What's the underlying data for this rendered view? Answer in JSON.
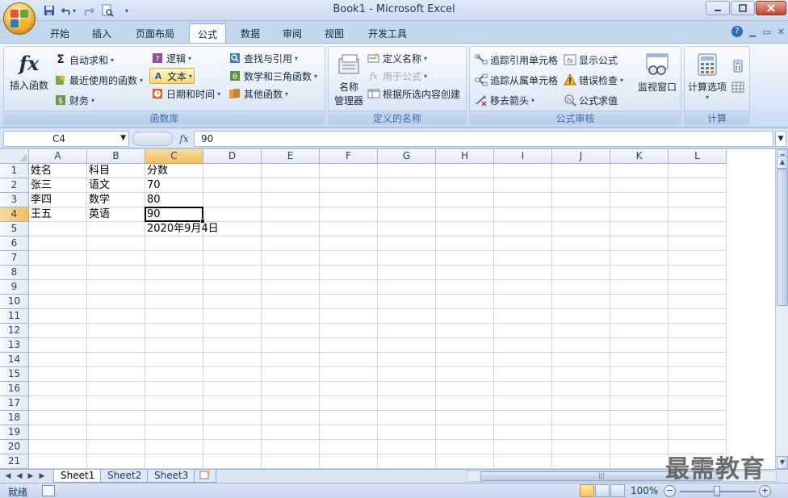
{
  "window": {
    "title": "Book1 - Microsoft Excel",
    "controls": [
      "minimize",
      "restore",
      "close"
    ]
  },
  "quick_access": [
    {
      "name": "save-icon",
      "label": "Save"
    },
    {
      "name": "undo-icon",
      "label": "Undo"
    },
    {
      "name": "redo-icon",
      "label": "Redo"
    },
    {
      "name": "print-preview-icon",
      "label": "Print Preview"
    },
    {
      "name": "customize-qat-icon",
      "label": "Customize"
    }
  ],
  "ribbon_tabs": [
    "开始",
    "插入",
    "页面布局",
    "公式",
    "数据",
    "审阅",
    "视图",
    "开发工具"
  ],
  "active_tab": "公式",
  "ribbon": {
    "function_library": {
      "label": "函数库",
      "insert_function": "插入函数",
      "autosum": "自动求和",
      "recent": "最近使用的函数",
      "financial": "财务",
      "logical": "逻辑",
      "text": "文本",
      "datetime": "日期和时间",
      "lookup": "查找与引用",
      "math": "数学和三角函数",
      "more": "其他函数"
    },
    "defined_names": {
      "label": "定义的名称",
      "name_manager": "名称\n管理器",
      "name_manager_line1": "名称",
      "name_manager_line2": "管理器",
      "define_name": "定义名称",
      "use_in_formula": "用于公式",
      "create_from_selection": "根据所选内容创建"
    },
    "formula_auditing": {
      "label": "公式审核",
      "trace_precedents": "追踪引用单元格",
      "trace_dependents": "追踪从属单元格",
      "remove_arrows": "移去箭头",
      "show_formulas": "显示公式",
      "error_checking": "错误检查",
      "evaluate_formula": "公式求值",
      "watch_window": "监视窗口"
    },
    "calculation": {
      "label": "计算",
      "options": "计算选项"
    }
  },
  "formula_bar": {
    "name_box": "C4",
    "fx": "fx",
    "content": "90"
  },
  "columns": [
    "A",
    "B",
    "C",
    "D",
    "E",
    "F",
    "G",
    "H",
    "I",
    "J",
    "K",
    "L"
  ],
  "rows": [
    "1",
    "2",
    "3",
    "4",
    "5",
    "6",
    "7",
    "8",
    "9",
    "10",
    "11",
    "12",
    "13",
    "14",
    "15",
    "16",
    "17",
    "18",
    "19",
    "20",
    "21"
  ],
  "selected_cell": "C4",
  "cells": [
    {
      "ref": "A1",
      "value": "姓名"
    },
    {
      "ref": "B1",
      "value": "科目"
    },
    {
      "ref": "C1",
      "value": "分数"
    },
    {
      "ref": "A2",
      "value": "张三"
    },
    {
      "ref": "B2",
      "value": "语文"
    },
    {
      "ref": "C2",
      "value": "70"
    },
    {
      "ref": "A3",
      "value": "李四"
    },
    {
      "ref": "B3",
      "value": "数学"
    },
    {
      "ref": "C3",
      "value": "80"
    },
    {
      "ref": "A4",
      "value": "王五"
    },
    {
      "ref": "B4",
      "value": "英语"
    },
    {
      "ref": "C4",
      "value": "90"
    },
    {
      "ref": "C5",
      "value": "2020年9月4日"
    }
  ],
  "sheets": [
    "Sheet1",
    "Sheet2",
    "Sheet3"
  ],
  "active_sheet": "Sheet1",
  "status": {
    "mode": "就绪",
    "zoom": "100%"
  },
  "watermark": "最需教育",
  "colors": {
    "selected_header": "#f1c15f",
    "ribbon_label": "#3e6aa8",
    "gridline": "#d0d7e5"
  }
}
